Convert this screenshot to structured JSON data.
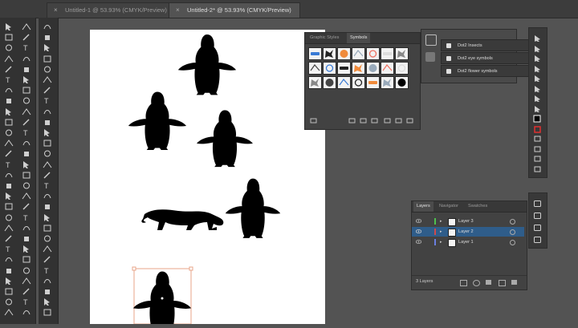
{
  "tabs": [
    {
      "label": "Untitled-1 @ 53.93% (CMYK/Preview)",
      "active": false
    },
    {
      "label": "Untitled-2* @ 53.93% (CMYK/Preview)",
      "active": true
    }
  ],
  "graphic_styles_panel": {
    "tabs": [
      "Graphic Styles",
      "Symbols"
    ],
    "active_tab": "Symbols"
  },
  "libraries_menu": {
    "items": [
      "Dot2 Insects",
      "Dot2 eye symbols",
      "Dot2 flower symbols"
    ]
  },
  "layers_panel": {
    "tabs": [
      "Layers",
      "Navigator",
      "Swatches"
    ],
    "active_tab": "Layers",
    "layers": [
      {
        "name": "Layer 3",
        "color": "#4ec04e",
        "selected": false
      },
      {
        "name": "Layer 2",
        "color": "#d04a4a",
        "selected": true
      },
      {
        "name": "Layer 1",
        "color": "#6a7fe0",
        "selected": false
      }
    ],
    "footer": "3 Layers"
  },
  "colors": {
    "selection": "#e8a58a",
    "layer_selected_bg": "#2f5d8a"
  }
}
